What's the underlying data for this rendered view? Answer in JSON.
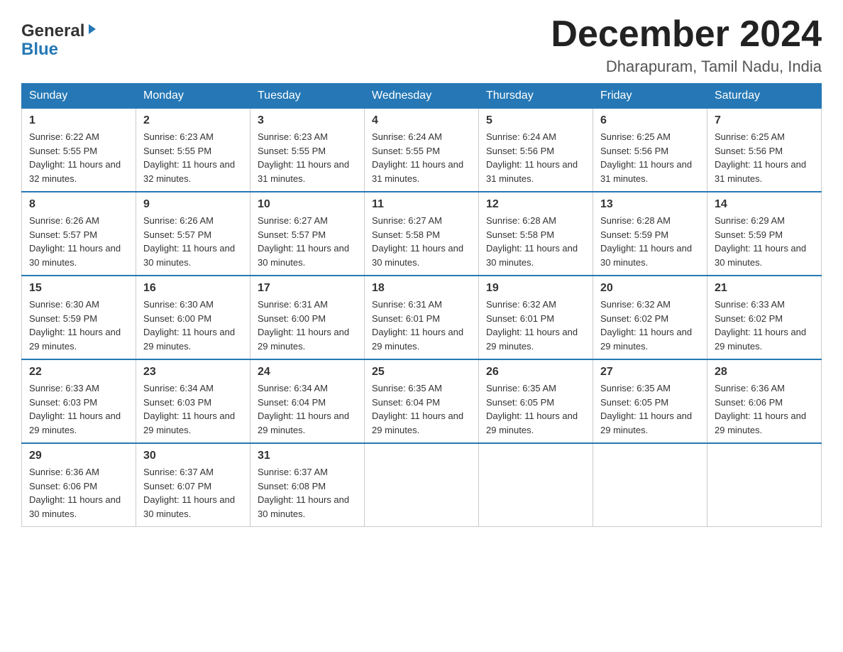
{
  "header": {
    "logo_general": "General",
    "logo_blue": "Blue",
    "month_title": "December 2024",
    "location": "Dharapuram, Tamil Nadu, India"
  },
  "weekdays": [
    "Sunday",
    "Monday",
    "Tuesday",
    "Wednesday",
    "Thursday",
    "Friday",
    "Saturday"
  ],
  "weeks": [
    [
      {
        "day": "1",
        "sunrise": "6:22 AM",
        "sunset": "5:55 PM",
        "daylight": "11 hours and 32 minutes."
      },
      {
        "day": "2",
        "sunrise": "6:23 AM",
        "sunset": "5:55 PM",
        "daylight": "11 hours and 32 minutes."
      },
      {
        "day": "3",
        "sunrise": "6:23 AM",
        "sunset": "5:55 PM",
        "daylight": "11 hours and 31 minutes."
      },
      {
        "day": "4",
        "sunrise": "6:24 AM",
        "sunset": "5:55 PM",
        "daylight": "11 hours and 31 minutes."
      },
      {
        "day": "5",
        "sunrise": "6:24 AM",
        "sunset": "5:56 PM",
        "daylight": "11 hours and 31 minutes."
      },
      {
        "day": "6",
        "sunrise": "6:25 AM",
        "sunset": "5:56 PM",
        "daylight": "11 hours and 31 minutes."
      },
      {
        "day": "7",
        "sunrise": "6:25 AM",
        "sunset": "5:56 PM",
        "daylight": "11 hours and 31 minutes."
      }
    ],
    [
      {
        "day": "8",
        "sunrise": "6:26 AM",
        "sunset": "5:57 PM",
        "daylight": "11 hours and 30 minutes."
      },
      {
        "day": "9",
        "sunrise": "6:26 AM",
        "sunset": "5:57 PM",
        "daylight": "11 hours and 30 minutes."
      },
      {
        "day": "10",
        "sunrise": "6:27 AM",
        "sunset": "5:57 PM",
        "daylight": "11 hours and 30 minutes."
      },
      {
        "day": "11",
        "sunrise": "6:27 AM",
        "sunset": "5:58 PM",
        "daylight": "11 hours and 30 minutes."
      },
      {
        "day": "12",
        "sunrise": "6:28 AM",
        "sunset": "5:58 PM",
        "daylight": "11 hours and 30 minutes."
      },
      {
        "day": "13",
        "sunrise": "6:28 AM",
        "sunset": "5:59 PM",
        "daylight": "11 hours and 30 minutes."
      },
      {
        "day": "14",
        "sunrise": "6:29 AM",
        "sunset": "5:59 PM",
        "daylight": "11 hours and 30 minutes."
      }
    ],
    [
      {
        "day": "15",
        "sunrise": "6:30 AM",
        "sunset": "5:59 PM",
        "daylight": "11 hours and 29 minutes."
      },
      {
        "day": "16",
        "sunrise": "6:30 AM",
        "sunset": "6:00 PM",
        "daylight": "11 hours and 29 minutes."
      },
      {
        "day": "17",
        "sunrise": "6:31 AM",
        "sunset": "6:00 PM",
        "daylight": "11 hours and 29 minutes."
      },
      {
        "day": "18",
        "sunrise": "6:31 AM",
        "sunset": "6:01 PM",
        "daylight": "11 hours and 29 minutes."
      },
      {
        "day": "19",
        "sunrise": "6:32 AM",
        "sunset": "6:01 PM",
        "daylight": "11 hours and 29 minutes."
      },
      {
        "day": "20",
        "sunrise": "6:32 AM",
        "sunset": "6:02 PM",
        "daylight": "11 hours and 29 minutes."
      },
      {
        "day": "21",
        "sunrise": "6:33 AM",
        "sunset": "6:02 PM",
        "daylight": "11 hours and 29 minutes."
      }
    ],
    [
      {
        "day": "22",
        "sunrise": "6:33 AM",
        "sunset": "6:03 PM",
        "daylight": "11 hours and 29 minutes."
      },
      {
        "day": "23",
        "sunrise": "6:34 AM",
        "sunset": "6:03 PM",
        "daylight": "11 hours and 29 minutes."
      },
      {
        "day": "24",
        "sunrise": "6:34 AM",
        "sunset": "6:04 PM",
        "daylight": "11 hours and 29 minutes."
      },
      {
        "day": "25",
        "sunrise": "6:35 AM",
        "sunset": "6:04 PM",
        "daylight": "11 hours and 29 minutes."
      },
      {
        "day": "26",
        "sunrise": "6:35 AM",
        "sunset": "6:05 PM",
        "daylight": "11 hours and 29 minutes."
      },
      {
        "day": "27",
        "sunrise": "6:35 AM",
        "sunset": "6:05 PM",
        "daylight": "11 hours and 29 minutes."
      },
      {
        "day": "28",
        "sunrise": "6:36 AM",
        "sunset": "6:06 PM",
        "daylight": "11 hours and 29 minutes."
      }
    ],
    [
      {
        "day": "29",
        "sunrise": "6:36 AM",
        "sunset": "6:06 PM",
        "daylight": "11 hours and 30 minutes."
      },
      {
        "day": "30",
        "sunrise": "6:37 AM",
        "sunset": "6:07 PM",
        "daylight": "11 hours and 30 minutes."
      },
      {
        "day": "31",
        "sunrise": "6:37 AM",
        "sunset": "6:08 PM",
        "daylight": "11 hours and 30 minutes."
      },
      null,
      null,
      null,
      null
    ]
  ],
  "labels": {
    "sunrise": "Sunrise:",
    "sunset": "Sunset:",
    "daylight": "Daylight:"
  }
}
